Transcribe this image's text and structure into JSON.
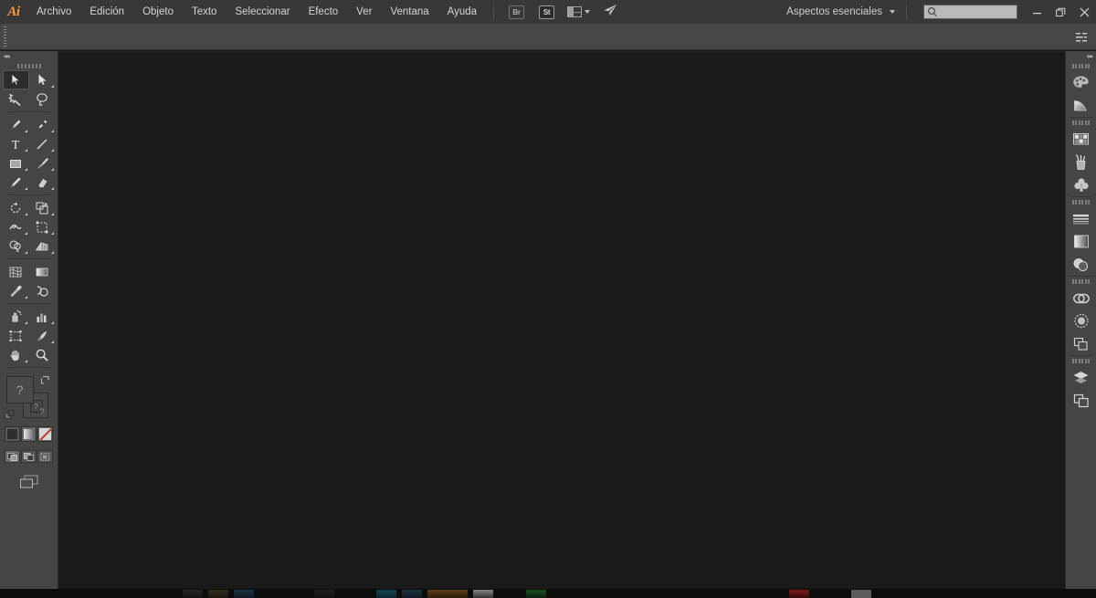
{
  "app": {
    "name": "Adobe Illustrator",
    "logo_text": "Ai"
  },
  "menubar": {
    "items": [
      {
        "label": "Archivo",
        "name": "menu-archivo"
      },
      {
        "label": "Edición",
        "name": "menu-edicion"
      },
      {
        "label": "Objeto",
        "name": "menu-objeto"
      },
      {
        "label": "Texto",
        "name": "menu-texto"
      },
      {
        "label": "Seleccionar",
        "name": "menu-seleccionar"
      },
      {
        "label": "Efecto",
        "name": "menu-efecto"
      },
      {
        "label": "Ver",
        "name": "menu-ver"
      },
      {
        "label": "Ventana",
        "name": "menu-ventana"
      },
      {
        "label": "Ayuda",
        "name": "menu-ayuda"
      }
    ],
    "bridge_label": "Br",
    "stock_label": "St",
    "workspace_label": "Aspectos esenciales",
    "search_placeholder": "",
    "search_value": "",
    "window_minimize": "—",
    "window_restore": "❐",
    "window_close": "✕"
  },
  "toolbar": {
    "collapse_label": "◂◂",
    "tools": [
      {
        "name": "selection-tool",
        "label": "Selección",
        "active": true,
        "flyout": false
      },
      {
        "name": "direct-selection-tool",
        "label": "Selección directa",
        "active": false,
        "flyout": true
      },
      {
        "name": "magic-wand-tool",
        "label": "Varita mágica",
        "active": false,
        "flyout": false
      },
      {
        "name": "lasso-tool",
        "label": "Lazo",
        "active": false,
        "flyout": false
      },
      {
        "name": "pen-tool",
        "label": "Pluma",
        "active": false,
        "flyout": true
      },
      {
        "name": "curvature-tool",
        "label": "Curvatura",
        "active": false,
        "flyout": true
      },
      {
        "name": "type-tool",
        "label": "Texto",
        "active": false,
        "flyout": true
      },
      {
        "name": "line-segment-tool",
        "label": "Segmento de línea",
        "active": false,
        "flyout": true
      },
      {
        "name": "rectangle-tool",
        "label": "Rectángulo",
        "active": false,
        "flyout": true
      },
      {
        "name": "paintbrush-tool",
        "label": "Pincel",
        "active": false,
        "flyout": true
      },
      {
        "name": "pencil-tool",
        "label": "Lápiz",
        "active": false,
        "flyout": true
      },
      {
        "name": "eraser-tool",
        "label": "Borrador",
        "active": false,
        "flyout": true
      },
      {
        "name": "rotate-tool",
        "label": "Rotar",
        "active": false,
        "flyout": true
      },
      {
        "name": "scale-tool",
        "label": "Escala",
        "active": false,
        "flyout": true
      },
      {
        "name": "width-tool",
        "label": "Anchura",
        "active": false,
        "flyout": true
      },
      {
        "name": "free-transform-tool",
        "label": "Transformación libre",
        "active": false,
        "flyout": true
      },
      {
        "name": "shape-builder-tool",
        "label": "Creador de formas",
        "active": false,
        "flyout": true
      },
      {
        "name": "perspective-grid-tool",
        "label": "Cuadrícula de perspectiva",
        "active": false,
        "flyout": true
      },
      {
        "name": "mesh-tool",
        "label": "Malla",
        "active": false,
        "flyout": false
      },
      {
        "name": "gradient-tool",
        "label": "Degradado",
        "active": false,
        "flyout": false
      },
      {
        "name": "eyedropper-tool",
        "label": "Cuentagotas",
        "active": false,
        "flyout": true
      },
      {
        "name": "blend-tool",
        "label": "Fusión",
        "active": false,
        "flyout": false
      },
      {
        "name": "symbol-sprayer-tool",
        "label": "Rociar símbolo",
        "active": false,
        "flyout": true
      },
      {
        "name": "column-graph-tool",
        "label": "Gráfico de columnas",
        "active": false,
        "flyout": true
      },
      {
        "name": "artboard-tool",
        "label": "Mesa de trabajo",
        "active": false,
        "flyout": false
      },
      {
        "name": "slice-tool",
        "label": "Sector",
        "active": false,
        "flyout": true
      },
      {
        "name": "hand-tool",
        "label": "Mano",
        "active": false,
        "flyout": true
      },
      {
        "name": "zoom-tool",
        "label": "Zoom",
        "active": false,
        "flyout": false
      }
    ],
    "fill_value": "?",
    "stroke_value": "?",
    "swap_label": "Intercambiar relleno y trazo",
    "default_label": "Relleno y trazo por defecto",
    "color_modes": [
      {
        "name": "color-mode-solid",
        "label": "Color",
        "selected": true
      },
      {
        "name": "color-mode-gradient",
        "label": "Degradado",
        "selected": false
      },
      {
        "name": "color-mode-none",
        "label": "Ninguno",
        "selected": false
      }
    ],
    "draw_modes": [
      {
        "name": "draw-normal-mode",
        "label": "Dibujar normal",
        "selected": true
      },
      {
        "name": "draw-behind-mode",
        "label": "Dibujar detrás",
        "selected": false
      },
      {
        "name": "draw-inside-mode",
        "label": "Dibujar dentro",
        "selected": false
      }
    ],
    "screen_mode_label": "Cambiar modo de pantalla"
  },
  "controlbar": {
    "grip_label": "Mover barra de control",
    "menu_label": "Menú del panel"
  },
  "dock": {
    "collapse_label": "▸▸",
    "groups": [
      {
        "items": [
          {
            "name": "color-panel-icon",
            "label": "Color"
          },
          {
            "name": "color-guide-panel-icon",
            "label": "Guía de color"
          }
        ]
      },
      {
        "items": [
          {
            "name": "swatches-panel-icon",
            "label": "Muestras"
          },
          {
            "name": "brushes-panel-icon",
            "label": "Pinceles"
          },
          {
            "name": "symbols-panel-icon",
            "label": "Símbolos"
          }
        ]
      },
      {
        "items": [
          {
            "name": "stroke-panel-icon",
            "label": "Trazo"
          },
          {
            "name": "gradient-panel-icon",
            "label": "Degradado"
          },
          {
            "name": "transparency-panel-icon",
            "label": "Transparencia"
          }
        ]
      },
      {
        "items": [
          {
            "name": "appearance-panel-icon",
            "label": "Apariencia"
          },
          {
            "name": "graphic-styles-panel-icon",
            "label": "Estilos gráficos"
          },
          {
            "name": "pathfinder-panel-icon",
            "label": "Buscatrazos"
          }
        ]
      },
      {
        "items": [
          {
            "name": "layers-panel-icon",
            "label": "Capas"
          },
          {
            "name": "artboards-panel-icon",
            "label": "Mesas de trabajo"
          }
        ]
      }
    ]
  },
  "canvas": {
    "background_color": "#1a1a1a",
    "document_open": false
  },
  "taskbar": {
    "visible": true,
    "background_color": "#0d0d0d"
  },
  "colors": {
    "menubar_bg": "#383838",
    "controlbar_bg": "#474747",
    "panel_bg": "#454545",
    "canvas_bg": "#1a1a1a",
    "accent": "#ff9a3c",
    "text": "#d4d4d4"
  }
}
